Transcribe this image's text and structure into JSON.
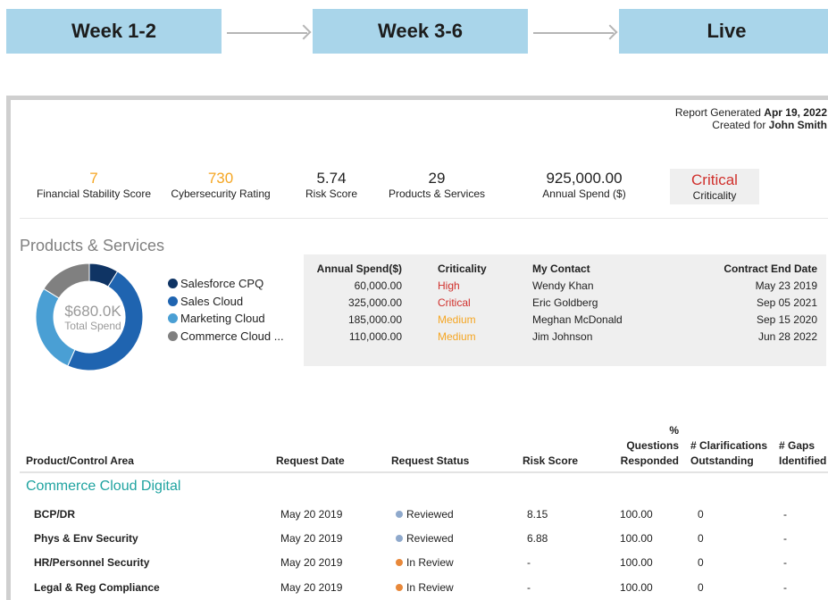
{
  "timeline": {
    "phases": [
      "Week 1-2",
      "Week 3-6",
      "Live"
    ]
  },
  "report": {
    "generated_label": "Report Generated",
    "generated_date": "Apr 19, 2022",
    "created_for_label": "Created for",
    "created_for_name": "John Smith"
  },
  "kpis": [
    {
      "value": "7",
      "label": "Financial Stability Score",
      "color": "#f5a623"
    },
    {
      "value": "730",
      "label": "Cybersecurity Rating",
      "color": "#f5a623"
    },
    {
      "value": "5.74",
      "label": "Risk Score",
      "color": "#222222"
    },
    {
      "value": "29",
      "label": "Products & Services",
      "color": "#222222"
    },
    {
      "value": "925,000.00",
      "label": "Annual Spend ($)",
      "color": "#222222"
    },
    {
      "value": "Critical",
      "label": "Criticality",
      "color": "#d0302c"
    }
  ],
  "products": {
    "title": "Products & Services",
    "total_amount": "$680.0K",
    "total_label": "Total Spend",
    "legend": [
      {
        "name": "Salesforce CPQ",
        "color": "#0f3464",
        "spend": 60000
      },
      {
        "name": "Sales Cloud",
        "color": "#1f64b0",
        "spend": 325000
      },
      {
        "name": "Marketing Cloud",
        "color": "#4a9fd4",
        "spend": 185000
      },
      {
        "name": "Commerce Cloud ...",
        "color": "#808080",
        "spend": 110000
      }
    ],
    "table": {
      "headers": {
        "spend": "Annual Spend($)",
        "criticality": "Criticality",
        "contact": "My Contact",
        "end_date": "Contract End Date"
      },
      "rows": [
        {
          "spend": "60,000.00",
          "criticality": "High",
          "crit_class": "crit-high",
          "contact": "Wendy Khan",
          "end_date": "May 23 2019"
        },
        {
          "spend": "325,000.00",
          "criticality": "Critical",
          "crit_class": "crit-critical",
          "contact": "Eric Goldberg",
          "end_date": "Sep 05 2021"
        },
        {
          "spend": "185,000.00",
          "criticality": "Medium",
          "crit_class": "crit-medium",
          "contact": "Meghan McDonald",
          "end_date": "Sep 15 2020"
        },
        {
          "spend": "110,000.00",
          "criticality": "Medium",
          "crit_class": "crit-medium",
          "contact": "Jim Johnson",
          "end_date": "Jun 28 2022"
        }
      ]
    }
  },
  "requests": {
    "headers": {
      "area": "Product/Control Area",
      "date": "Request Date",
      "status": "Request Status",
      "risk": "Risk Score",
      "pct_line1": "% Questions",
      "pct_line2": "Responded",
      "clar_line1": "# Clarifications",
      "clar_line2": "Outstanding",
      "gaps_line1": "# Gaps",
      "gaps_line2": "Identified"
    },
    "group": "Commerce Cloud Digital",
    "rows": [
      {
        "area": "BCP/DR",
        "date": "May 20 2019",
        "status": "Reviewed",
        "status_color": "#8fa9cc",
        "risk": "8.15",
        "pct": "100.00",
        "clar": "0",
        "gaps": "-"
      },
      {
        "area": "Phys & Env Security",
        "date": "May 20 2019",
        "status": "Reviewed",
        "status_color": "#8fa9cc",
        "risk": "6.88",
        "pct": "100.00",
        "clar": "0",
        "gaps": "-"
      },
      {
        "area": "HR/Personnel Security",
        "date": "May 20 2019",
        "status": "In Review",
        "status_color": "#e8883a",
        "risk": "-",
        "pct": "100.00",
        "clar": "0",
        "gaps": "-"
      },
      {
        "area": "Legal & Reg Compliance",
        "date": "May 20 2019",
        "status": "In Review",
        "status_color": "#e8883a",
        "risk": "-",
        "pct": "100.00",
        "clar": "0",
        "gaps": "-"
      }
    ]
  }
}
